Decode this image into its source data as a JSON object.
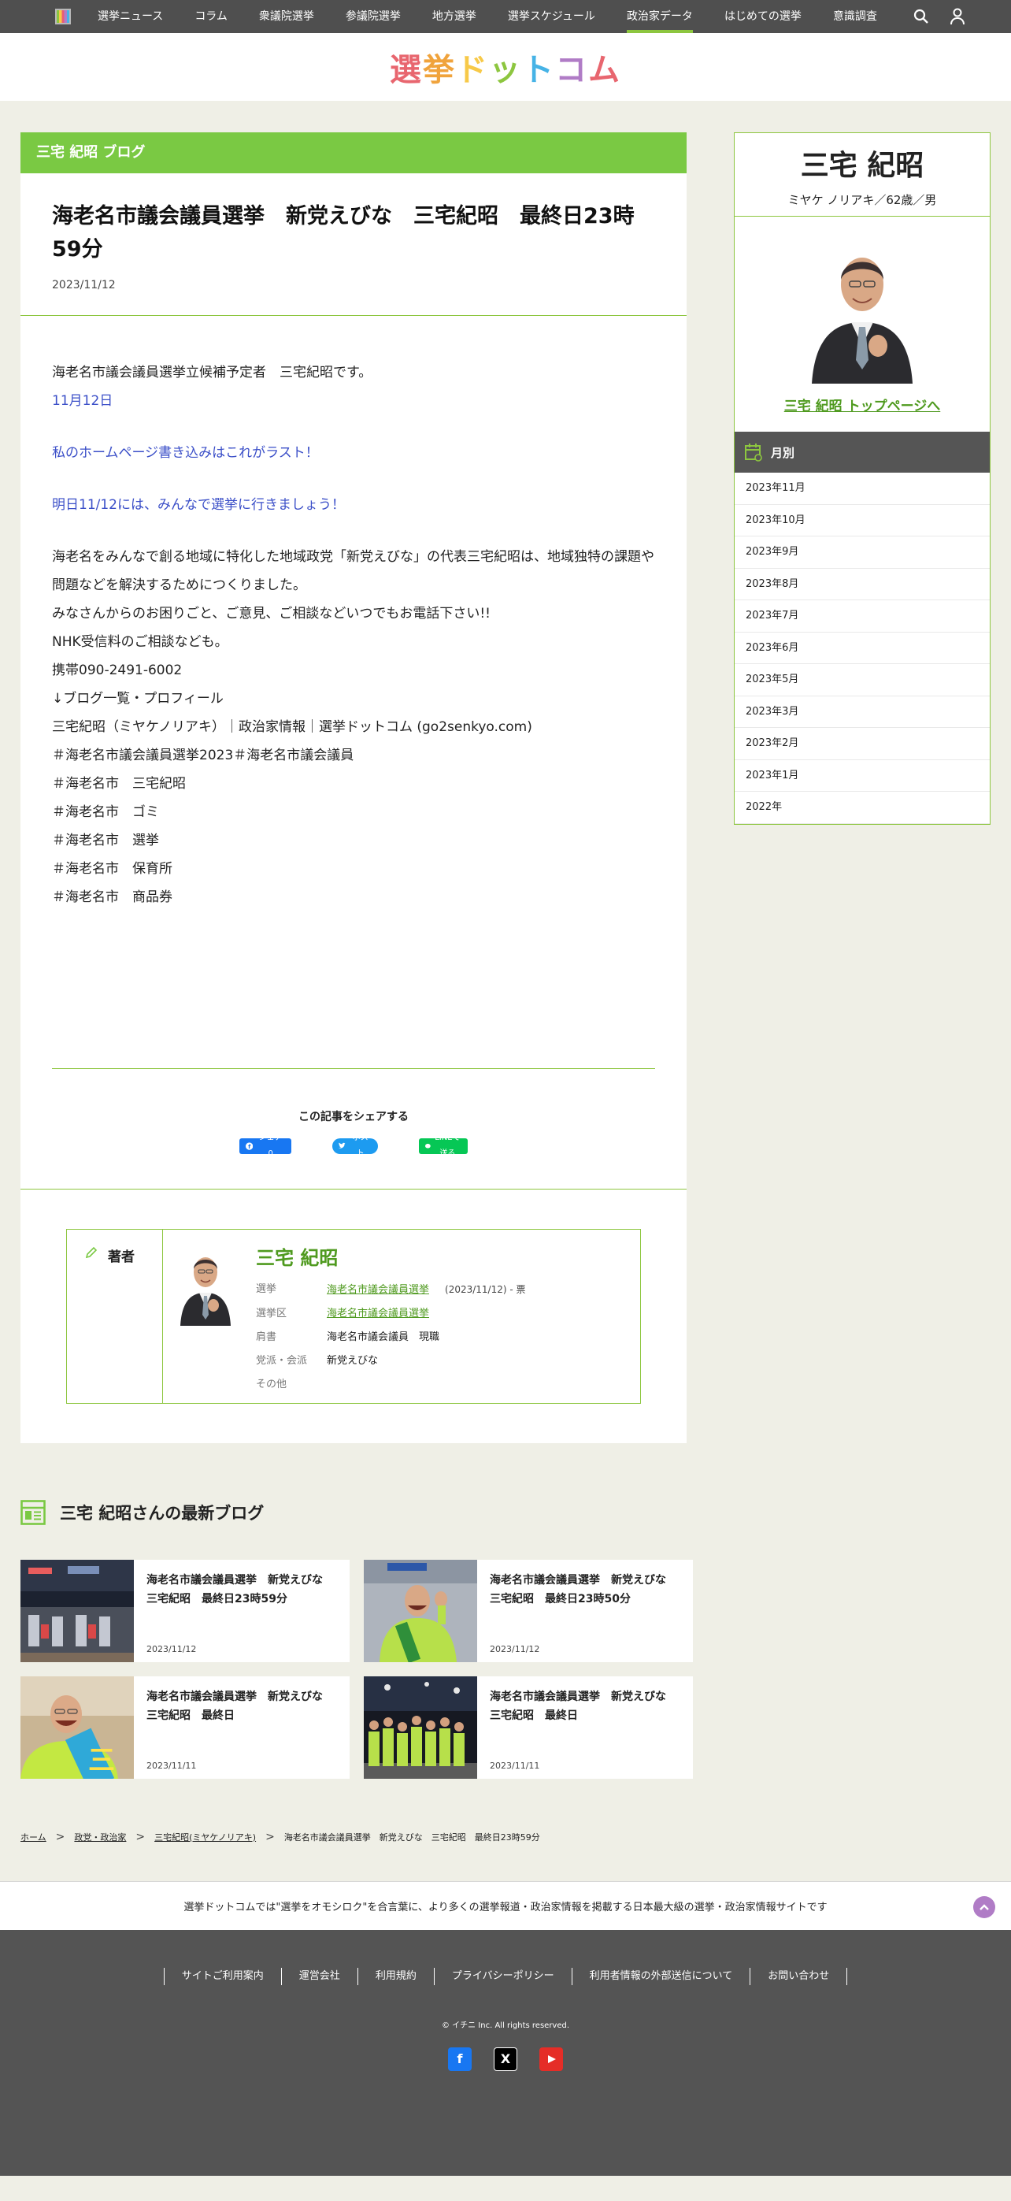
{
  "nav": {
    "items": [
      "選挙ニュース",
      "コラム",
      "衆議院選挙",
      "参議院選挙",
      "地方選挙",
      "選挙スケジュール",
      "政治家データ",
      "はじめての選挙",
      "意識調査"
    ],
    "active_index": 6
  },
  "brand": {
    "chars": [
      "選",
      "挙",
      "ド",
      "ッ",
      "ト",
      "コ",
      "ム"
    ]
  },
  "blog_band": "三宅 紀昭 ブログ",
  "article": {
    "title": "海老名市議会議員選挙　新党えびな　三宅紀昭　最終日23時59分",
    "date": "2023/11/12",
    "lines": {
      "l1": "海老名市議会議員選挙立候補予定者　三宅紀昭です。",
      "l2": "11月12日",
      "l3": "私のホームページ書き込みはこれがラスト！",
      "l4": "明日11/12には、みんなで選挙に行きましょう！",
      "l5": "海老名をみんなで創る地域に特化した地域政党「新党えびな」の代表三宅紀昭は、地域独特の課題や問題などを解決するためにつくりました。",
      "l6": "みなさんからのお困りごと、ご意見、ご相談などいつでもお電話下さい!!",
      "l7": "NHK受信料のご相談なども。",
      "l8": "携帯090-2491-6002",
      "l9": "↓ブログ一覧・プロフィール",
      "l10": "三宅紀昭（ミヤケノリアキ）｜政治家情報｜選挙ドットコム (go2senkyo.com)",
      "l11": "＃海老名市議会議員選挙2023＃海老名市議会議員",
      "l12": "＃海老名市　三宅紀昭",
      "l13": "＃海老名市　ゴミ",
      "l14": "＃海老名市　選挙",
      "l15": "＃海老名市　保育所",
      "l16": "＃海老名市　商品券"
    }
  },
  "share": {
    "title": "この記事をシェアする",
    "fb": "シェア 0",
    "tw": "ポスト",
    "line": "LINEで送る"
  },
  "author": {
    "label": "著者",
    "name": "三宅 紀昭",
    "rows": {
      "election_k": "選挙",
      "election_v": "海老名市議会議員選挙",
      "election_note": "(2023/11/12) - 票",
      "district_k": "選挙区",
      "district_v": "海老名市議会議員選挙",
      "title_k": "肩書",
      "title_v": "海老名市議会議員　現職",
      "party_k": "党派・会派",
      "party_v": "新党えびな",
      "other_k": "その他",
      "other_v": ""
    }
  },
  "latest": {
    "heading": "三宅 紀昭さんの最新ブログ",
    "cards": [
      {
        "title": "海老名市議会議員選挙　新党えびな　三宅紀昭　最終日23時59分",
        "date": "2023/11/12"
      },
      {
        "title": "海老名市議会議員選挙　新党えびな　三宅紀昭　最終日23時50分",
        "date": "2023/11/12"
      },
      {
        "title": "海老名市議会議員選挙　新党えびな　三宅紀昭　最終日",
        "date": "2023/11/11"
      },
      {
        "title": "海老名市議会議員選挙　新党えびな　三宅紀昭　最終日",
        "date": "2023/11/11"
      }
    ]
  },
  "breadcrumb": {
    "home": "ホーム",
    "parties": "政党・政治家",
    "person": "三宅紀昭(ミヤケノリアキ)",
    "current": "海老名市議会議員選挙　新党えびな　三宅紀昭　最終日23時59分"
  },
  "profile": {
    "name": "三宅 紀昭",
    "sub": "ミヤケ ノリアキ／62歳／男",
    "link": "三宅 紀昭 トップページへ"
  },
  "months": {
    "heading": "月別",
    "items": [
      "2023年11月",
      "2023年10月",
      "2023年9月",
      "2023年8月",
      "2023年7月",
      "2023年6月",
      "2023年5月",
      "2023年3月",
      "2023年2月",
      "2023年1月",
      "2022年"
    ]
  },
  "footer": {
    "tagline": "選挙ドットコムでは\"選挙をオモシロク\"を合言葉に、より多くの選挙報道・政治家情報を掲載する日本最大級の選挙・政治家情報サイトです",
    "links": [
      "サイトご利用案内",
      "運営会社",
      "利用規約",
      "プライバシーポリシー",
      "利用者情報の外部送信について",
      "お問い合わせ"
    ],
    "copyright": "© イチニ Inc. All rights reserved."
  },
  "colors": {
    "accent_green": "#7ac943",
    "link_green": "#4f9a1f",
    "nav_bg": "#4f4f4f",
    "page_bg": "#efefe6",
    "blue_text": "#3b4fc8"
  }
}
